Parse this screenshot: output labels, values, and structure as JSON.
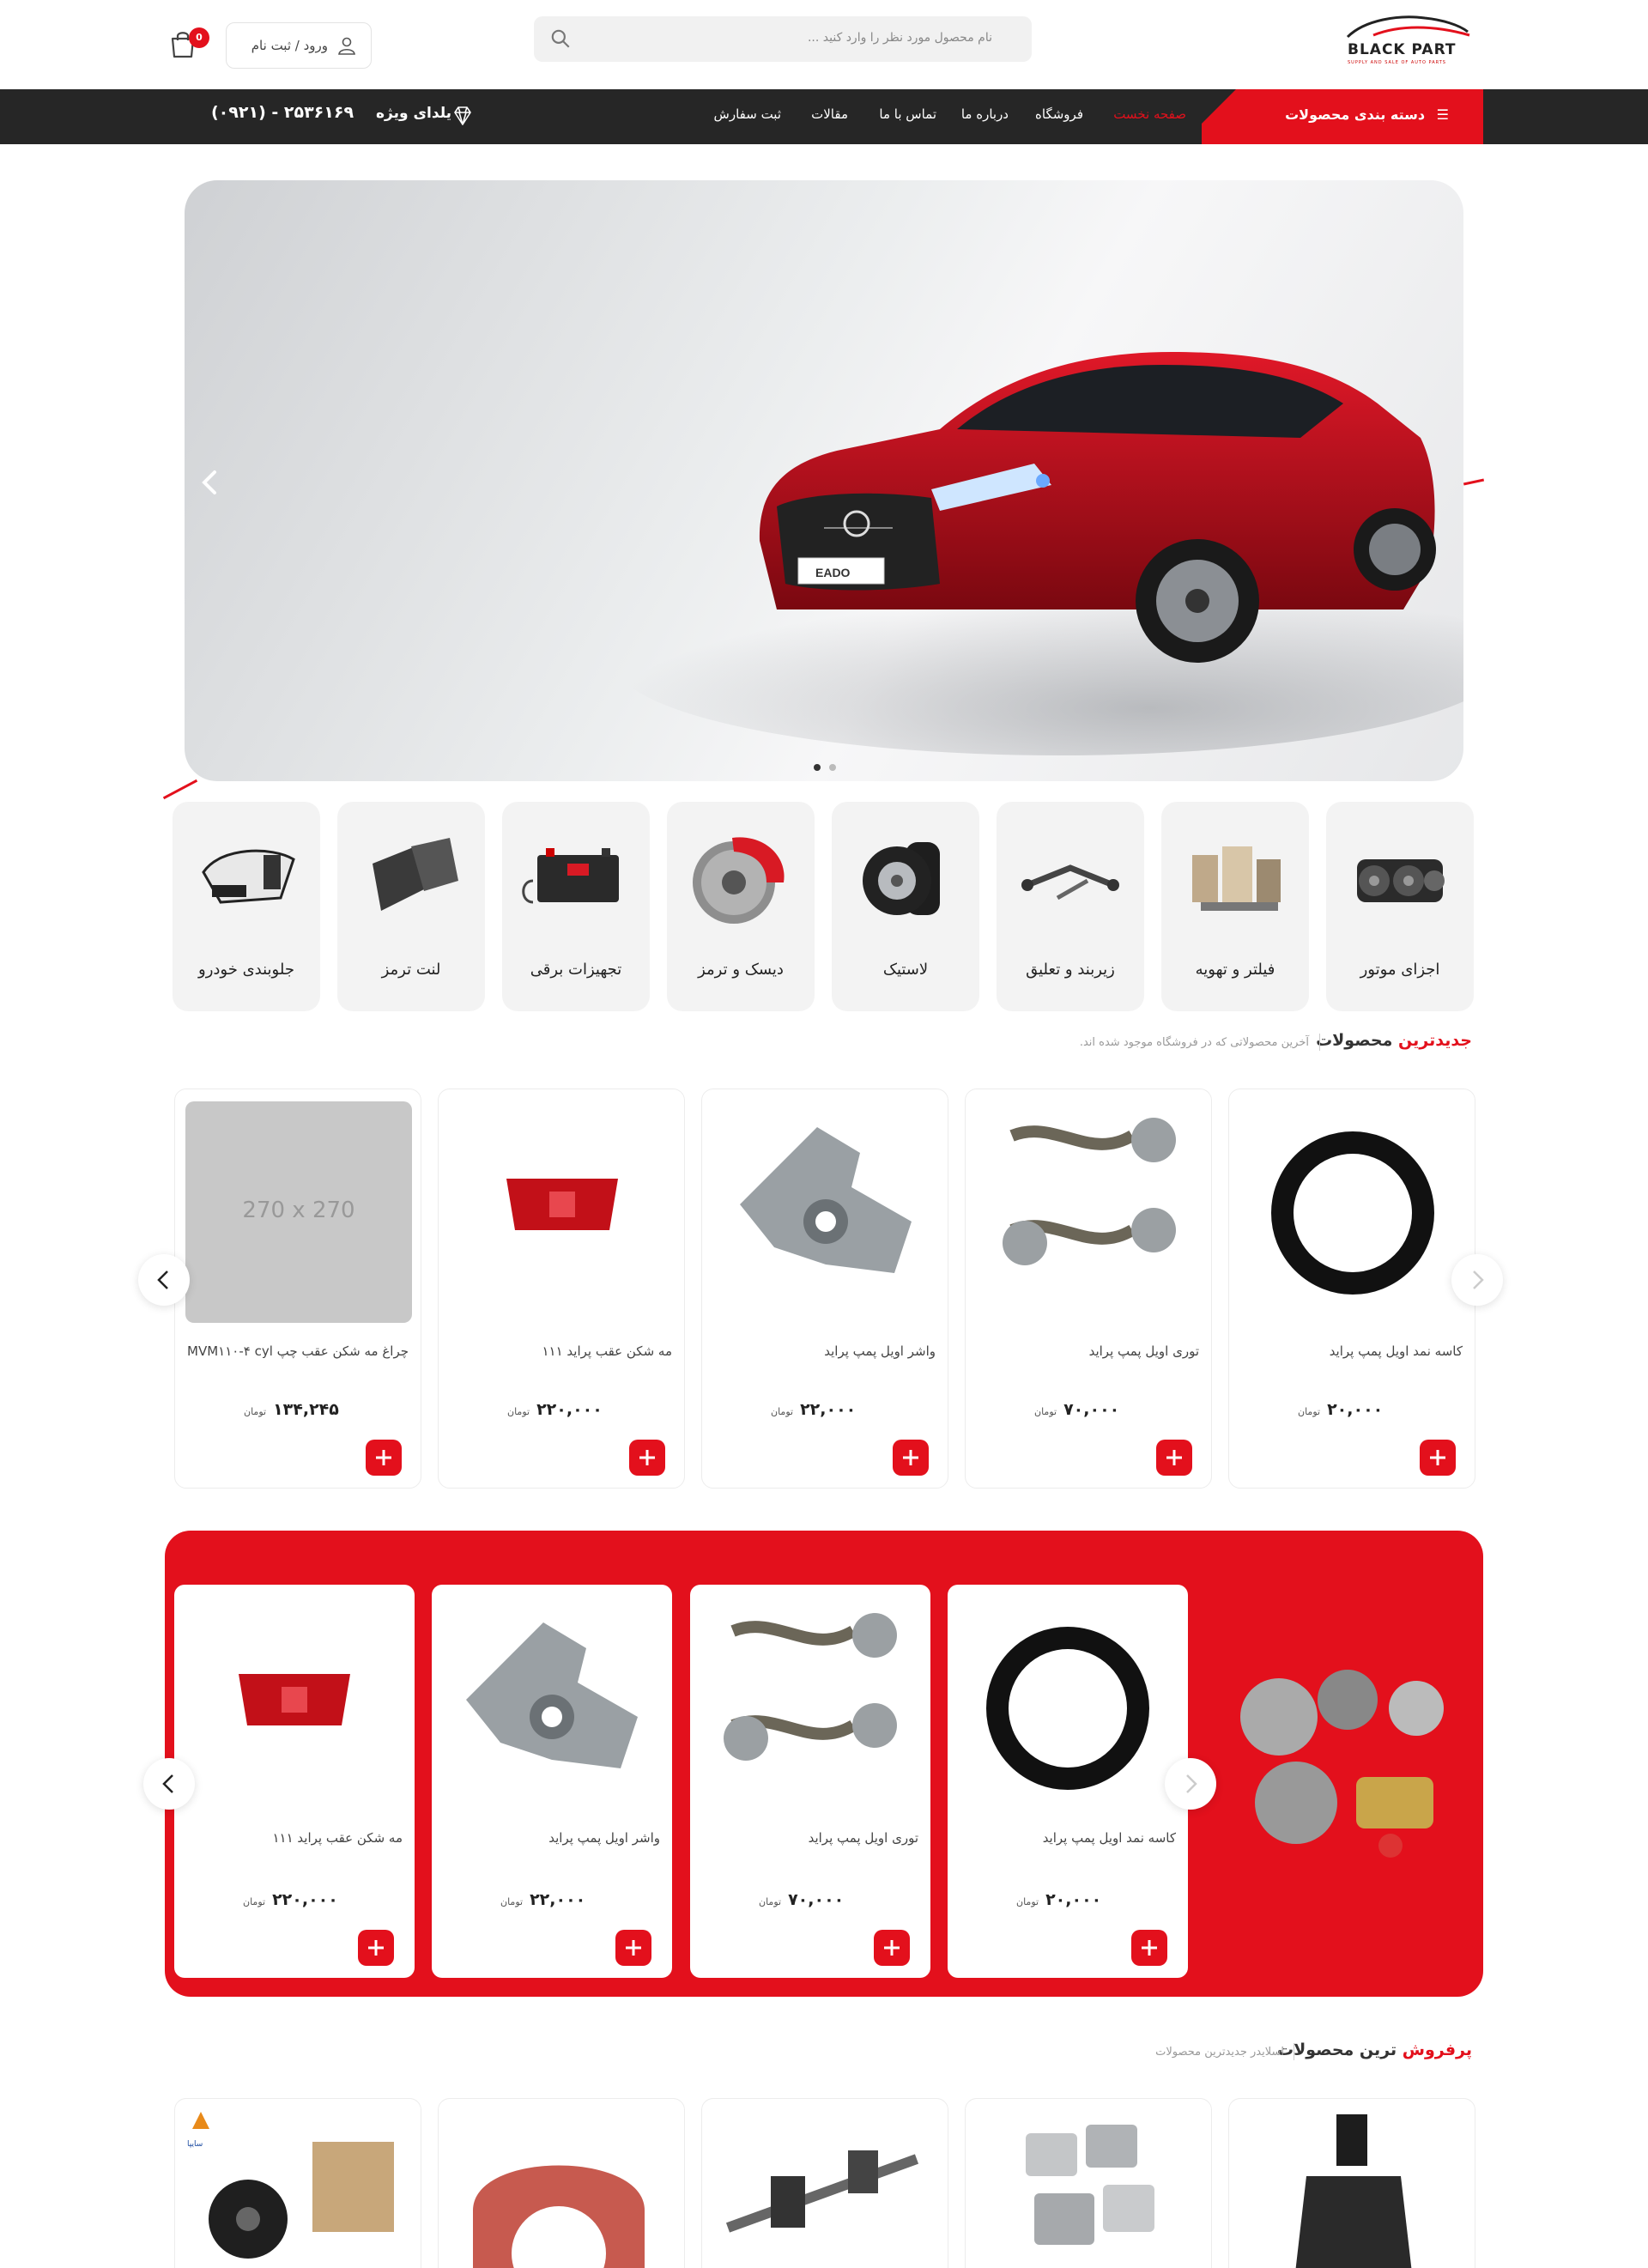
{
  "header": {
    "logo_text": "BLACK PART",
    "logo_tagline": "SUPPLY AND SALE OF AUTO PARTS",
    "search_placeholder": "نام محصول مورد نظر را وارد کنید ...",
    "login_label": "ورود / ثبت نام",
    "cart_count": "0"
  },
  "nav": {
    "category_button": "دسته بندی محصولات",
    "items": [
      "صفحه نخست",
      "فروشگاه",
      "درباره ما",
      "تماس با ما",
      "مقالات",
      "ثبت سفارش"
    ],
    "special_label": "یلدای ویژه",
    "phone": "(۰۹۲۱) - ۲۵۳۶۱۶۹"
  },
  "hero": {
    "plate_text": "EADO",
    "slides": 2,
    "active_slide": 1
  },
  "categories": [
    {
      "label": "اجزای موتور",
      "icon": "engine-parts-icon"
    },
    {
      "label": "فیلتر و تهویه",
      "icon": "filters-icon"
    },
    {
      "label": "زیربند و تعلیق",
      "icon": "suspension-icon"
    },
    {
      "label": "لاستیک",
      "icon": "tires-icon"
    },
    {
      "label": "دیسک و ترمز",
      "icon": "brake-disc-icon"
    },
    {
      "label": "تجهیزات برقی",
      "icon": "battery-icon"
    },
    {
      "label": "لنت ترمز",
      "icon": "brake-pad-icon"
    },
    {
      "label": "جلوبندی خودرو",
      "icon": "front-axle-icon"
    }
  ],
  "newest": {
    "title_red": "جدیدترین",
    "title_rest": "محصولات",
    "subtitle": "آخرین محصولاتی که در فروشگاه موجود شده اند.",
    "currency": "تومان",
    "products": [
      {
        "name": "کاسه نمد اویل پمپ پراید",
        "price": "۲۰,۰۰۰",
        "image": "oil-seal"
      },
      {
        "name": "توری اویل پمپ پراید",
        "price": "۷۰,۰۰۰",
        "image": "oil-strainer"
      },
      {
        "name": "واشر اویل پمپ پراید",
        "price": "۲۲,۰۰۰",
        "image": "oil-pump"
      },
      {
        "name": "مه شکن عقب پراید ۱۱۱",
        "price": "۲۲۰,۰۰۰",
        "image": "rear-fog-lamp"
      },
      {
        "name": "چراغ مه شکن عقب چپ MVM۱۱۰-۴ cyl",
        "price": "۱۳۴,۲۴۵",
        "image": "placeholder",
        "placeholder_text": "270 x 270"
      }
    ]
  },
  "special_band": {
    "currency": "تومان",
    "products": [
      {
        "name": "کاسه نمد اویل پمپ پراید",
        "price": "۲۰,۰۰۰",
        "image": "oil-seal"
      },
      {
        "name": "توری اویل پمپ پراید",
        "price": "۷۰,۰۰۰",
        "image": "oil-strainer"
      },
      {
        "name": "واشر اویل پمپ پراید",
        "price": "۲۲,۰۰۰",
        "image": "oil-pump"
      },
      {
        "name": "مه شکن عقب پراید ۱۱۱",
        "price": "۲۲۰,۰۰۰",
        "image": "rear-fog-lamp"
      }
    ]
  },
  "bestsellers": {
    "title_red": "پرفروش",
    "title_rest": "ترین محصولات",
    "subtitle": "اسلایدر جدیدترین محصولات",
    "brand_mark": "سایپا"
  },
  "colors": {
    "accent": "#e3101c",
    "dark": "#262626"
  }
}
